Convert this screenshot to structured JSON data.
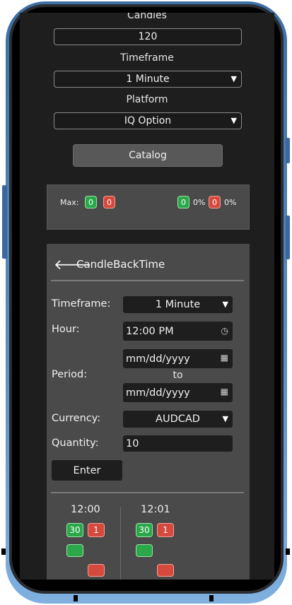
{
  "form": {
    "candles_label": "Candles",
    "candles_value": "120",
    "timeframe_label": "Timeframe",
    "timeframe_value": "1 Minute",
    "platform_label": "Platform",
    "platform_value": "IQ Option",
    "catalog_button": "Catalog"
  },
  "stats": {
    "max_label": "Max:",
    "max_green": "0",
    "max_red": "0",
    "win_count": "0",
    "win_pct": "0%",
    "loss_count": "0",
    "loss_pct": "0%"
  },
  "panel": {
    "title": "CandleBackTime",
    "timeframe_label": "Timeframe:",
    "timeframe_value": "1 Minute",
    "hour_label": "Hour:",
    "hour_value": "12:00  PM",
    "period_label": "Period:",
    "period_from_placeholder": "mm/dd/yyyy",
    "period_to_label": "to",
    "period_to_placeholder": "mm/dd/yyyy",
    "currency_label": "Currency:",
    "currency_value": "AUDCAD",
    "quantity_label": "Quantity:",
    "quantity_value": "10",
    "enter_button": "Enter"
  },
  "results": [
    {
      "time": "12:00",
      "green": "30",
      "red": "1"
    },
    {
      "time": "12:01",
      "green": "30",
      "red": "1"
    }
  ],
  "icons": {
    "back": "arrow-left-icon",
    "clock": "clock-icon",
    "calendar": "calendar-icon",
    "dropdown": "chevron-down-icon"
  },
  "colors": {
    "background": "#1e1e1e",
    "panel": "#4a4a4a",
    "green": "#2aa84a",
    "red": "#d64a3e",
    "frame": "#3c6fa3"
  }
}
